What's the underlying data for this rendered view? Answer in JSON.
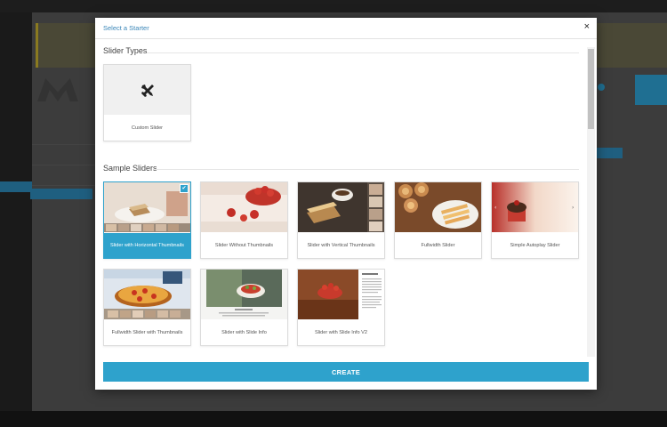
{
  "modal": {
    "title": "Select a Starter",
    "close_glyph": "×"
  },
  "sections": {
    "slider_types": "Slider Types",
    "sample_sliders": "Sample Sliders"
  },
  "slider_types": [
    {
      "label": "Custom Slider",
      "icon": "tools-icon"
    }
  ],
  "sample_sliders": [
    {
      "label": "Slider with Horizontal Thumbnails",
      "selected": true
    },
    {
      "label": "Slider Without Thumbnails",
      "selected": false
    },
    {
      "label": "Slider with Vertical Thumbnails",
      "selected": false
    },
    {
      "label": "Fullwidth Slider",
      "selected": false
    },
    {
      "label": "Simple Autoplay Slider",
      "selected": false
    },
    {
      "label": "Fullwidth Slider with Thumbnails",
      "selected": false
    },
    {
      "label": "Slider with Slide Info",
      "selected": false
    },
    {
      "label": "Slider with Slide Info V2",
      "selected": false
    }
  ],
  "footer": {
    "create_label": "CREATE"
  },
  "colors": {
    "accent": "#2ea2cc",
    "title": "#3a86b8"
  }
}
